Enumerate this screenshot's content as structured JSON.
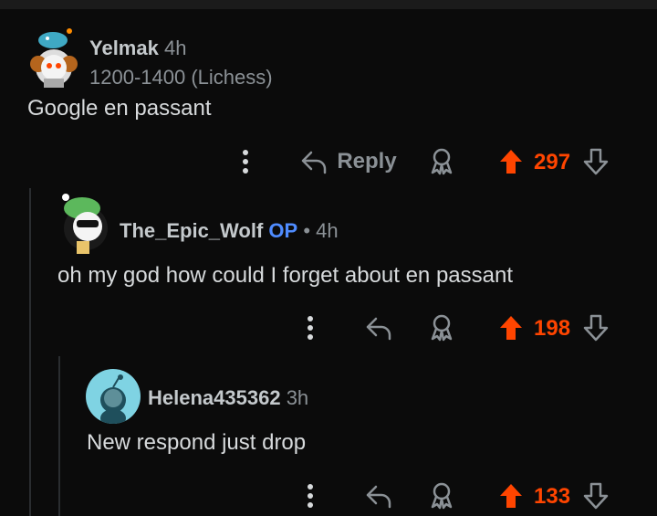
{
  "comments": [
    {
      "author": "Yelmak",
      "time": "4h",
      "flair": "1200-1400 (Lichess)",
      "body": "Google en passant",
      "reply_label": "Reply",
      "score": "297"
    },
    {
      "author": "The_Epic_Wolf",
      "op_badge": "OP",
      "separator": "•",
      "time": "4h",
      "body": "oh my god how could I forget about en passant",
      "score": "198"
    },
    {
      "author": "Helena435362",
      "time": "3h",
      "body": "New respond just drop",
      "score": "133"
    }
  ],
  "colors": {
    "background": "#0b0b0b",
    "upvoted": "#ff4500",
    "op": "#4f8cff",
    "muted": "#8b9196"
  },
  "icons": [
    "more-options-icon",
    "reply-arrow-icon",
    "award-icon",
    "upvote-arrow-icon",
    "downvote-arrow-icon"
  ]
}
